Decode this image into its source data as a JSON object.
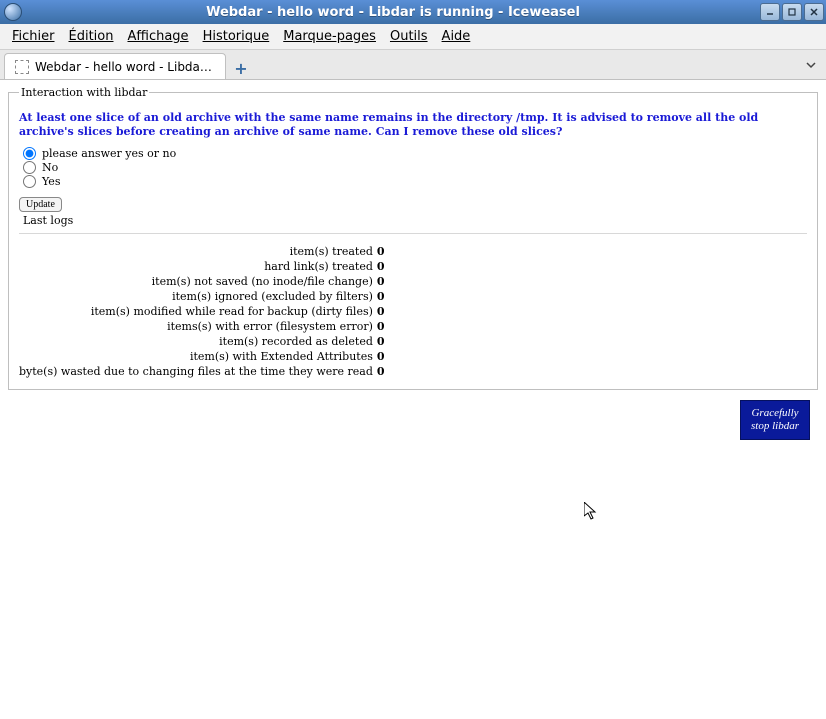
{
  "window": {
    "title": "Webdar - hello word - Libdar is running - Iceweasel"
  },
  "menu": {
    "items": [
      {
        "label": "Fichier",
        "accel": "F"
      },
      {
        "label": "Édition",
        "accel": "É"
      },
      {
        "label": "Affichage",
        "accel": "A"
      },
      {
        "label": "Historique",
        "accel": "H"
      },
      {
        "label": "Marque-pages",
        "accel": "M"
      },
      {
        "label": "Outils",
        "accel": "O"
      },
      {
        "label": "Aide",
        "accel": "A"
      }
    ]
  },
  "tab": {
    "label": "Webdar - hello word - Libdar is r..."
  },
  "panel": {
    "legend": "Interaction with libdar",
    "question": "At least one slice of an old archive with the same name remains in the directory /tmp. It is advised to remove all the old archive's slices before creating an archive of same name. Can I remove these old slices?",
    "options": [
      {
        "label": "please answer yes or no",
        "selected": true
      },
      {
        "label": "No",
        "selected": false
      },
      {
        "label": "Yes",
        "selected": false
      }
    ],
    "update_label": "Update",
    "lastlogs_label": "Last logs",
    "stats": [
      {
        "label": "item(s) treated",
        "value": "0"
      },
      {
        "label": "hard link(s) treated",
        "value": "0"
      },
      {
        "label": "item(s) not saved (no inode/file change)",
        "value": "0"
      },
      {
        "label": "item(s) ignored (excluded by filters)",
        "value": "0"
      },
      {
        "label": "item(s) modified while read for backup (dirty files)",
        "value": "0"
      },
      {
        "label": "items(s) with error (filesystem error)",
        "value": "0"
      },
      {
        "label": "item(s) recorded as deleted",
        "value": "0"
      },
      {
        "label": "item(s) with Extended Attributes",
        "value": "0"
      },
      {
        "label": "byte(s) wasted due to changing files at the time they were read",
        "value": "0"
      }
    ]
  },
  "stop_button": {
    "line1": "Gracefully",
    "line2": "stop libdar"
  }
}
